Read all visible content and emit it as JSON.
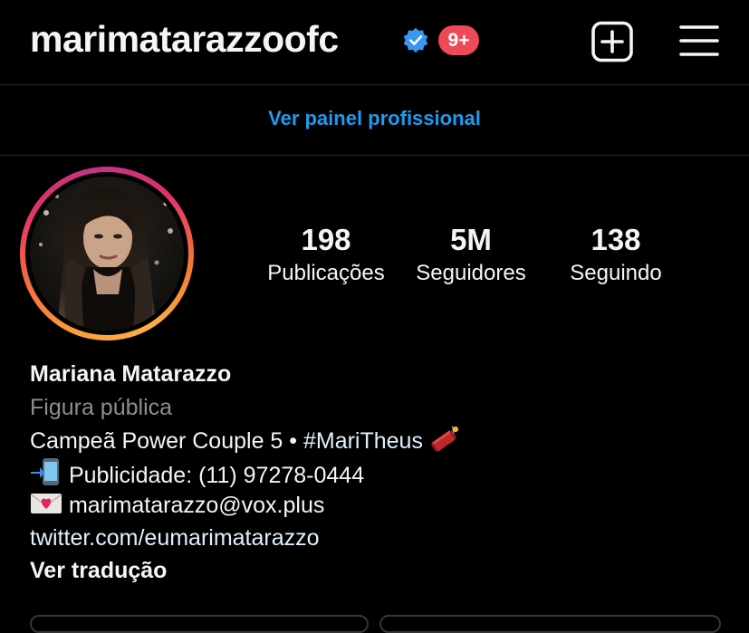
{
  "header": {
    "username": "marimatarazzoofc",
    "notification_count": "9+",
    "icons": {
      "verified": "verified-badge-icon",
      "new_post": "new-post-icon",
      "menu": "menu-icon"
    },
    "colors": {
      "verified": "#3897f0",
      "badge": "#ed4956"
    }
  },
  "dashboard": {
    "link_label": "Ver painel profissional",
    "color": "#1d9bf0"
  },
  "stats": {
    "posts": {
      "value": "198",
      "label": "Publicações"
    },
    "followers": {
      "value": "5M",
      "label": "Seguidores"
    },
    "following": {
      "value": "138",
      "label": "Seguindo"
    }
  },
  "bio": {
    "name": "Mariana Matarazzo",
    "category": "Figura pública",
    "line1_text": "Campeã Power Couple 5 • ",
    "line1_hashtag": "#MariTheus",
    "line1_emoji": "firecracker-icon",
    "line2_emoji": "mobile-phone-icon",
    "line2_text": "Publicidade: (11) 97278-0444",
    "line3_emoji": "love-letter-icon",
    "line3_text": "marimatarazzo@vox.plus",
    "link": "twitter.com/eumarimatarazzo",
    "translate_label": "Ver tradução"
  }
}
